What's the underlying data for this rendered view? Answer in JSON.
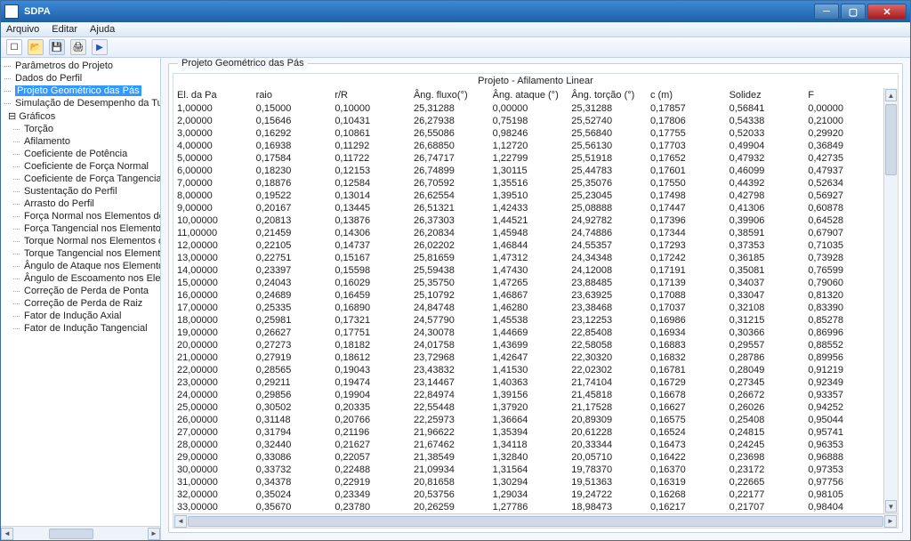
{
  "app": {
    "title": "SDPA"
  },
  "menu": {
    "arquivo": "Arquivo",
    "editar": "Editar",
    "ajuda": "Ajuda"
  },
  "tree": {
    "items": [
      "Parâmetros do Projeto",
      "Dados do Perfil",
      "Projeto Geométrico das Pás",
      "Simulação de Desempenho da Turbina"
    ],
    "graficos_label": "Gráficos",
    "graficos": [
      "Torção",
      "Afilamento",
      "Coeficiente de Potência",
      "Coeficiente de Força Normal",
      "Coeficiente de Força Tangencial",
      "Sustentação do Perfil",
      "Arrasto do Perfil",
      "Força Normal nos Elementos de Pá",
      "Força Tangencial nos  Elementos d",
      "Torque Normal nos Elementos de P",
      "Torque Tangencial nos  Elementos c",
      "Ângulo de Ataque nos Elementos de",
      "Ângulo de Escoamento nos Elemento",
      "Correção de Perda  de Ponta",
      "Correção de Perda  de Raiz",
      "Fator de Indução Axial",
      "Fator de Indução Tangencial"
    ],
    "selected_index": 2
  },
  "panel": {
    "legend": "Projeto Geométrico das Pás",
    "subtitle": "Projeto - Afilamento Linear"
  },
  "table": {
    "columns": [
      "El. da Pa",
      "raio",
      "r/R",
      "Âng. fluxo(°)",
      "Âng. ataque (°)",
      "Âng. torção (°)",
      "c (m)",
      "Solidez",
      "F"
    ],
    "rows": [
      [
        "1,00000",
        "0,15000",
        "0,10000",
        "25,31288",
        "0,00000",
        "25,31288",
        "0,17857",
        "0,56841",
        "0,00000"
      ],
      [
        "2,00000",
        "0,15646",
        "0,10431",
        "26,27938",
        "0,75198",
        "25,52740",
        "0,17806",
        "0,54338",
        "0,21000"
      ],
      [
        "3,00000",
        "0,16292",
        "0,10861",
        "26,55086",
        "0,98246",
        "25,56840",
        "0,17755",
        "0,52033",
        "0,29920"
      ],
      [
        "4,00000",
        "0,16938",
        "0,11292",
        "26,68850",
        "1,12720",
        "25,56130",
        "0,17703",
        "0,49904",
        "0,36849"
      ],
      [
        "5,00000",
        "0,17584",
        "0,11722",
        "26,74717",
        "1,22799",
        "25,51918",
        "0,17652",
        "0,47932",
        "0,42735"
      ],
      [
        "6,00000",
        "0,18230",
        "0,12153",
        "26,74899",
        "1,30115",
        "25,44783",
        "0,17601",
        "0,46099",
        "0,47937"
      ],
      [
        "7,00000",
        "0,18876",
        "0,12584",
        "26,70592",
        "1,35516",
        "25,35076",
        "0,17550",
        "0,44392",
        "0,52634"
      ],
      [
        "8,00000",
        "0,19522",
        "0,13014",
        "26,62554",
        "1,39510",
        "25,23045",
        "0,17498",
        "0,42798",
        "0,56927"
      ],
      [
        "9,00000",
        "0,20167",
        "0,13445",
        "26,51321",
        "1,42433",
        "25,08888",
        "0,17447",
        "0,41306",
        "0,60878"
      ],
      [
        "10,00000",
        "0,20813",
        "0,13876",
        "26,37303",
        "1,44521",
        "24,92782",
        "0,17396",
        "0,39906",
        "0,64528"
      ],
      [
        "11,00000",
        "0,21459",
        "0,14306",
        "26,20834",
        "1,45948",
        "24,74886",
        "0,17344",
        "0,38591",
        "0,67907"
      ],
      [
        "12,00000",
        "0,22105",
        "0,14737",
        "26,02202",
        "1,46844",
        "24,55357",
        "0,17293",
        "0,37353",
        "0,71035"
      ],
      [
        "13,00000",
        "0,22751",
        "0,15167",
        "25,81659",
        "1,47312",
        "24,34348",
        "0,17242",
        "0,36185",
        "0,73928"
      ],
      [
        "14,00000",
        "0,23397",
        "0,15598",
        "25,59438",
        "1,47430",
        "24,12008",
        "0,17191",
        "0,35081",
        "0,76599"
      ],
      [
        "15,00000",
        "0,24043",
        "0,16029",
        "25,35750",
        "1,47265",
        "23,88485",
        "0,17139",
        "0,34037",
        "0,79060"
      ],
      [
        "16,00000",
        "0,24689",
        "0,16459",
        "25,10792",
        "1,46867",
        "23,63925",
        "0,17088",
        "0,33047",
        "0,81320"
      ],
      [
        "17,00000",
        "0,25335",
        "0,16890",
        "24,84748",
        "1,46280",
        "23,38468",
        "0,17037",
        "0,32108",
        "0,83390"
      ],
      [
        "18,00000",
        "0,25981",
        "0,17321",
        "24,57790",
        "1,45538",
        "23,12253",
        "0,16986",
        "0,31215",
        "0,85278"
      ],
      [
        "19,00000",
        "0,26627",
        "0,17751",
        "24,30078",
        "1,44669",
        "22,85408",
        "0,16934",
        "0,30366",
        "0,86996"
      ],
      [
        "20,00000",
        "0,27273",
        "0,18182",
        "24,01758",
        "1,43699",
        "22,58058",
        "0,16883",
        "0,29557",
        "0,88552"
      ],
      [
        "21,00000",
        "0,27919",
        "0,18612",
        "23,72968",
        "1,42647",
        "22,30320",
        "0,16832",
        "0,28786",
        "0,89956"
      ],
      [
        "22,00000",
        "0,28565",
        "0,19043",
        "23,43832",
        "1,41530",
        "22,02302",
        "0,16781",
        "0,28049",
        "0,91219"
      ],
      [
        "23,00000",
        "0,29211",
        "0,19474",
        "23,14467",
        "1,40363",
        "21,74104",
        "0,16729",
        "0,27345",
        "0,92349"
      ],
      [
        "24,00000",
        "0,29856",
        "0,19904",
        "22,84974",
        "1,39156",
        "21,45818",
        "0,16678",
        "0,26672",
        "0,93357"
      ],
      [
        "25,00000",
        "0,30502",
        "0,20335",
        "22,55448",
        "1,37920",
        "21,17528",
        "0,16627",
        "0,26026",
        "0,94252"
      ],
      [
        "26,00000",
        "0,31148",
        "0,20766",
        "22,25973",
        "1,36664",
        "20,89309",
        "0,16575",
        "0,25408",
        "0,95044"
      ],
      [
        "27,00000",
        "0,31794",
        "0,21196",
        "21,96622",
        "1,35394",
        "20,61228",
        "0,16524",
        "0,24815",
        "0,95741"
      ],
      [
        "28,00000",
        "0,32440",
        "0,21627",
        "21,67462",
        "1,34118",
        "20,33344",
        "0,16473",
        "0,24245",
        "0,96353"
      ],
      [
        "29,00000",
        "0,33086",
        "0,22057",
        "21,38549",
        "1,32840",
        "20,05710",
        "0,16422",
        "0,23698",
        "0,96888"
      ],
      [
        "30,00000",
        "0,33732",
        "0,22488",
        "21,09934",
        "1,31564",
        "19,78370",
        "0,16370",
        "0,23172",
        "0,97353"
      ],
      [
        "31,00000",
        "0,34378",
        "0,22919",
        "20,81658",
        "1,30294",
        "19,51363",
        "0,16319",
        "0,22665",
        "0,97756"
      ],
      [
        "32,00000",
        "0,35024",
        "0,23349",
        "20,53756",
        "1,29034",
        "19,24722",
        "0,16268",
        "0,22177",
        "0,98105"
      ],
      [
        "33,00000",
        "0,35670",
        "0,23780",
        "20,26259",
        "1,27786",
        "18,98473",
        "0,16217",
        "0,21707",
        "0,98404"
      ]
    ]
  }
}
